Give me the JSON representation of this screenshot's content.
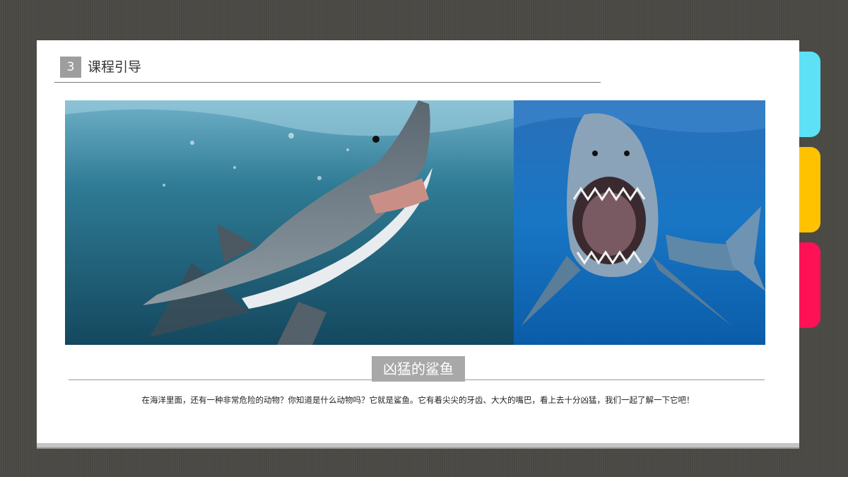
{
  "section": {
    "number": "3",
    "title": "课程引导"
  },
  "caption": "凶猛的鲨鱼",
  "body_text": "在海洋里面，还有一种非常危险的动物？你知道是什么动物吗？它就是鲨鱼。它有着尖尖的牙齿、大大的嘴巴，看上去十分凶猛，我们一起了解一下它吧！",
  "photos": [
    {
      "subject": "great-white-shark-breaching"
    },
    {
      "subject": "great-white-shark-open-jaws"
    }
  ],
  "colors": {
    "background": "#4a4843",
    "tab_cyan": "#5ce1f7",
    "tab_yellow": "#ffc200",
    "tab_red": "#ff1155",
    "badge_gray": "#a8a8a8"
  }
}
